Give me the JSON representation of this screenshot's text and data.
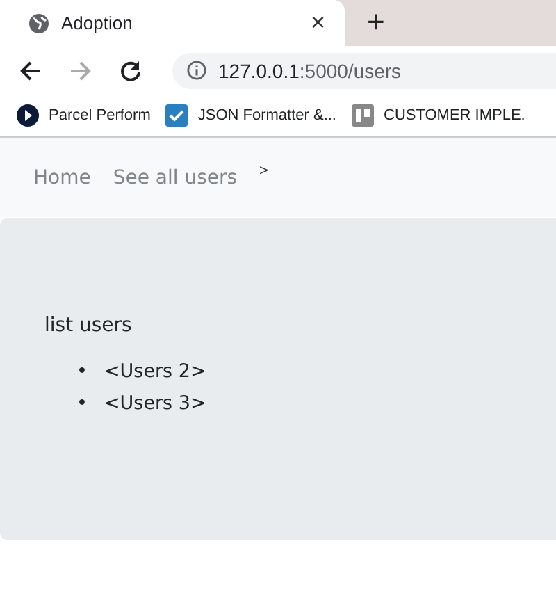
{
  "tab": {
    "title": "Adoption",
    "close": "×",
    "new_tab": "+"
  },
  "address_bar": {
    "host": "127.0.0.1",
    "path": ":5000/users"
  },
  "bookmarks": [
    {
      "kind": "circle",
      "label": "Parcel Perform"
    },
    {
      "kind": "check",
      "label": "JSON Formatter &..."
    },
    {
      "kind": "board",
      "label": "CUSTOMER IMPLE."
    }
  ],
  "navbar": {
    "links": [
      "Home",
      "See all users"
    ],
    "toggle": ">"
  },
  "content": {
    "heading": "list users",
    "items": [
      {
        "marker": "•",
        "text": "<Users 2>"
      },
      {
        "marker": "•",
        "text": "<Users 3>"
      }
    ]
  }
}
